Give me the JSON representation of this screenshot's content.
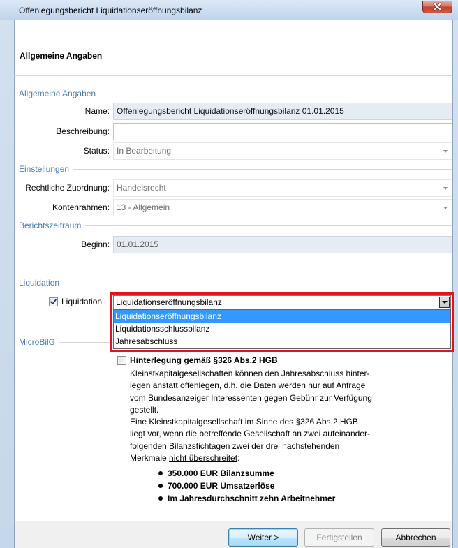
{
  "window": {
    "title": "Offenlegungsbericht Liquidationseröffnungsbilanz"
  },
  "header": {
    "title": "Allgemeine Angaben"
  },
  "general": {
    "section_title": "Allgemeine Angaben",
    "name": {
      "label": "Name:",
      "value": "Offenlegungsbericht Liquidationseröffnungsbilanz 01.01.2015"
    },
    "description": {
      "label": "Beschreibung:"
    },
    "status": {
      "label": "Status:",
      "value": "In Bearbeitung"
    }
  },
  "settings": {
    "section_title": "Einstellungen",
    "legal": {
      "label": "Rechtliche Zuordnung:",
      "value": "Handelsrecht"
    },
    "chart_of_accounts": {
      "label": "Kontenrahmen:",
      "value": "13 - Allgemein"
    }
  },
  "period": {
    "section_title": "Berichtszeitraum",
    "begin": {
      "label": "Beginn:",
      "value": "01.01.2015"
    }
  },
  "liquidation": {
    "section_title": "Liquidation",
    "checkbox": {
      "label": "Liquidation",
      "checked": true
    },
    "type": {
      "value": "Liquidationseröffnungsbilanz",
      "open": true,
      "options": [
        {
          "label": "Liquidationseröffnungsbilanz",
          "selected": true
        },
        {
          "label": "Liquidationsschlussbilanz",
          "selected": false
        },
        {
          "label": "Jahresabschluss",
          "selected": false
        }
      ]
    }
  },
  "microbilg": {
    "section_title": "MicroBilG",
    "checkbox": {
      "label": "Hinterlegung gemäß §326 Abs.2 HGB",
      "checked": false
    },
    "lines": [
      "Kleinstkapitalgesellschaften können den Jahresabschluss hinter-",
      "legen anstatt offenlegen, d.h. die Daten werden nur auf Anfrage",
      "vom Bundesanzeiger Interessenten gegen Gebühr zur Verfügung",
      "gestellt.",
      "Eine Kleinstkapitalgesellschaft im Sinne des §326 Abs.2 HGB",
      "liegt vor, wenn die betreffende Gesellschaft an zwei aufeinander-"
    ],
    "line_7": {
      "before": "folgenden Bilanzstichtagen ",
      "underlined": "zwei der drei",
      "after": " nachstehenden"
    },
    "line_8": {
      "before": "Merkmale ",
      "underlined": "nicht überschreitet",
      "after": ":"
    },
    "criteria": [
      "350.000 EUR Bilanzsumme",
      "700.000 EUR Umsatzerlöse",
      "Im Jahresdurchschnitt zehn Arbeitnehmer"
    ]
  },
  "buttons": {
    "next": {
      "label": "Weiter >",
      "enabled": true,
      "default": true
    },
    "finish": {
      "label": "Fertigstellen",
      "enabled": false
    },
    "cancel": {
      "label": "Abbrechen",
      "enabled": true
    }
  },
  "colors": {
    "section_title": "#4b7bb3",
    "selection": "#3399ff",
    "highlight_border": "#e1141c",
    "readonly_field": "#e6ecf3"
  },
  "icons": {
    "close": "close-icon",
    "dropdown": "chevron-down-icon",
    "checkbox_checked": "check-icon",
    "bullet": "bullet-icon"
  }
}
